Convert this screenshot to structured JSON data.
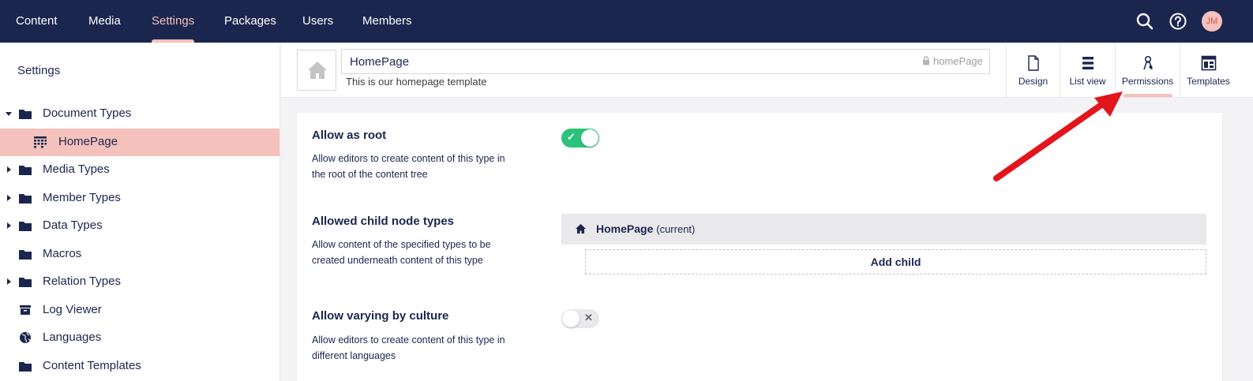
{
  "nav": {
    "items": [
      {
        "label": "Content"
      },
      {
        "label": "Media"
      },
      {
        "label": "Settings"
      },
      {
        "label": "Packages"
      },
      {
        "label": "Users"
      },
      {
        "label": "Members"
      }
    ],
    "active": "Settings",
    "avatar_initials": "JM"
  },
  "sidebar": {
    "title": "Settings",
    "items": [
      {
        "label": "Document Types",
        "icon": "folder-icon",
        "expanded": true
      },
      {
        "label": "HomePage",
        "icon": "doc-type-grid-icon",
        "selected": true
      },
      {
        "label": "Media Types",
        "icon": "folder-icon"
      },
      {
        "label": "Member Types",
        "icon": "folder-icon"
      },
      {
        "label": "Data Types",
        "icon": "folder-icon"
      },
      {
        "label": "Macros",
        "icon": "folder-icon"
      },
      {
        "label": "Relation Types",
        "icon": "folder-icon"
      },
      {
        "label": "Log Viewer",
        "icon": "archive-box-icon"
      },
      {
        "label": "Languages",
        "icon": "globe-icon"
      },
      {
        "label": "Content Templates",
        "icon": "folder-icon"
      }
    ]
  },
  "editor": {
    "name": "HomePage",
    "alias": "homePage",
    "description": "This is our homepage template",
    "apps": [
      {
        "label": "Design",
        "icon": "document-icon"
      },
      {
        "label": "List view",
        "icon": "list-icon"
      },
      {
        "label": "Permissions",
        "icon": "permissions-icon",
        "active": true
      },
      {
        "label": "Templates",
        "icon": "template-layout-icon"
      }
    ]
  },
  "properties": {
    "allow_root": {
      "label": "Allow as root",
      "description": "Allow editors to create content of this type in the root of the content tree",
      "enabled": true
    },
    "allowed_children": {
      "label": "Allowed child node types",
      "description": "Allow content of the specified types to be created underneath content of this type",
      "child_name": "HomePage",
      "child_suffix": "(current)",
      "add_label": "Add child"
    },
    "vary_by_culture": {
      "label": "Allow varying by culture",
      "description": "Allow editors to create content of this type in different languages",
      "enabled": false
    }
  },
  "colors": {
    "nav_bg": "#1b264f",
    "accent_pink": "#f5c1bc",
    "toggle_on": "#2bc37c",
    "annotation_arrow": "#e3141b"
  }
}
